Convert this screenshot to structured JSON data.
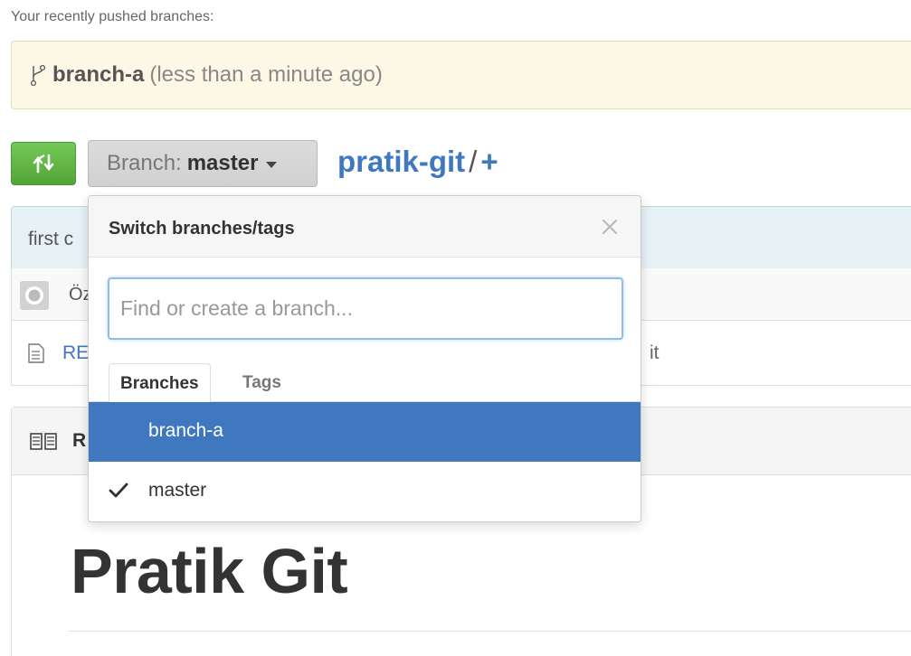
{
  "recent": {
    "label": "Your recently pushed branches:",
    "branch": "branch-a",
    "time": "(less than a minute ago)"
  },
  "toolbar": {
    "branch_prefix": "Branch:",
    "branch_value": "master",
    "repo_name": "pratik-git",
    "separator": "/",
    "add": "+"
  },
  "commit": {
    "message": "first c",
    "author": "Öz"
  },
  "files": [
    {
      "name": "RE",
      "message": "it"
    }
  ],
  "readme": {
    "header": "R",
    "heading": "Pratik Git"
  },
  "dropdown": {
    "title": "Switch branches/tags",
    "search_placeholder": "Find or create a branch...",
    "tabs": [
      "Branches",
      "Tags"
    ],
    "items": [
      {
        "label": "branch-a",
        "selected": true,
        "checked": false
      },
      {
        "label": "master",
        "selected": false,
        "checked": true
      }
    ]
  },
  "colors": {
    "link": "#4078c0",
    "selected_bg": "#4078c0",
    "compare_green": "#6cc644",
    "notice_bg": "#fcf8e5"
  }
}
